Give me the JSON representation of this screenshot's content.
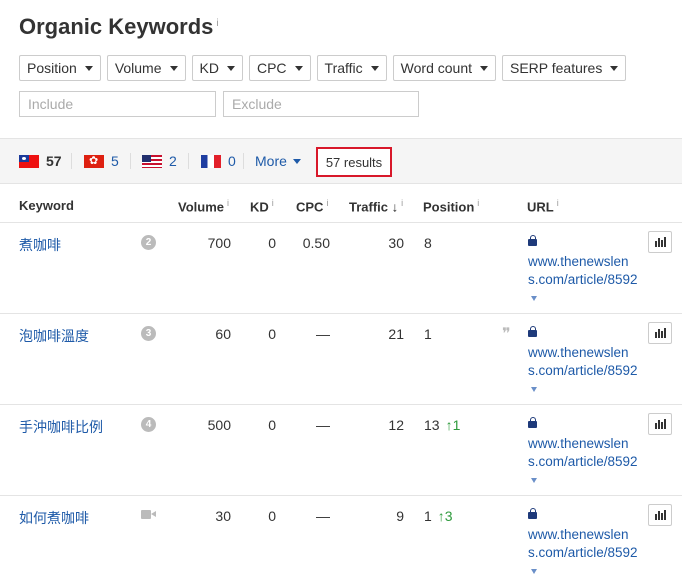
{
  "page": {
    "title": "Organic Keywords",
    "title_info": "i"
  },
  "filters": [
    {
      "label": "Position"
    },
    {
      "label": "Volume"
    },
    {
      "label": "KD"
    },
    {
      "label": "CPC"
    },
    {
      "label": "Traffic"
    },
    {
      "label": "Word count"
    },
    {
      "label": "SERP features"
    }
  ],
  "include": {
    "placeholder": "Include",
    "value": ""
  },
  "exclude": {
    "placeholder": "Exclude",
    "value": ""
  },
  "countries": [
    {
      "flag": "taiwan",
      "count": "57",
      "active": true
    },
    {
      "flag": "hong-kong",
      "count": "5"
    },
    {
      "flag": "united-states",
      "count": "2"
    },
    {
      "flag": "france",
      "count": "0"
    }
  ],
  "more_label": "More",
  "results_label": "57 results",
  "columns": {
    "keyword": "Keyword",
    "volume": "Volume",
    "kd": "KD",
    "cpc": "CPC",
    "traffic": "Traffic",
    "traffic_sort": "↓",
    "position": "Position",
    "url": "URL",
    "info": "i"
  },
  "rows": [
    {
      "keyword": "煮咖啡",
      "rank": "2",
      "volume": "700",
      "kd": "0",
      "cpc": "0.50",
      "traffic": "30",
      "position": "8",
      "change": "",
      "serp": "",
      "url": "www.thenewslens.com/article/8592"
    },
    {
      "keyword": "泡咖啡溫度",
      "rank": "3",
      "volume": "60",
      "kd": "0",
      "cpc": "—",
      "traffic": "21",
      "position": "1",
      "change": "",
      "serp": "quote",
      "url": "www.thenewslens.com/article/8592"
    },
    {
      "keyword": "手沖咖啡比例",
      "rank": "4",
      "volume": "500",
      "kd": "0",
      "cpc": "—",
      "traffic": "12",
      "position": "13",
      "change": "↑1",
      "serp": "",
      "url": "www.thenewslens.com/article/8592"
    },
    {
      "keyword": "如何煮咖啡",
      "rank": "",
      "volume": "30",
      "kd": "0",
      "cpc": "—",
      "traffic": "9",
      "position": "1",
      "change": "↑3",
      "serp": "video",
      "url": "www.thenewslens.com/article/8592"
    }
  ],
  "colors": {
    "link": "#1e5aa8",
    "highlight": "#d8182a",
    "positive": "#2e9a3c"
  },
  "icons": [
    "info-icon",
    "caret-down-icon",
    "lock-icon",
    "chart-icon",
    "quote-icon",
    "video-icon",
    "arrow-up-icon"
  ]
}
